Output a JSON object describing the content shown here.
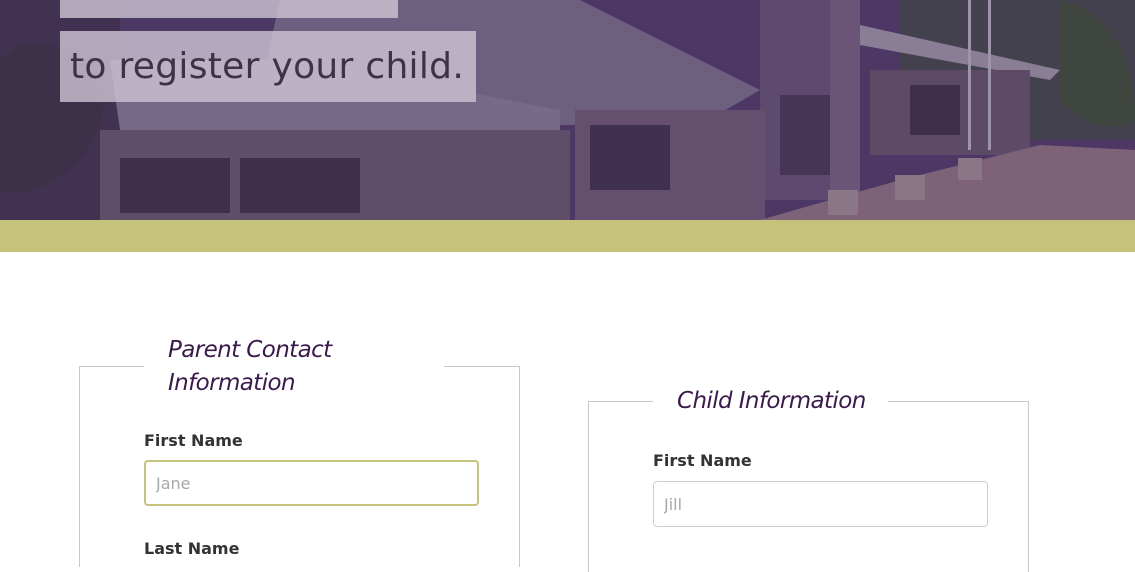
{
  "hero": {
    "headline_line2": "to register your child."
  },
  "parent_section": {
    "legend": "Parent Contact Information",
    "first_name": {
      "label": "First Name",
      "placeholder": "Jane",
      "value": ""
    },
    "last_name": {
      "label": "Last Name"
    }
  },
  "child_section": {
    "legend": "Child Information",
    "first_name": {
      "label": "First Name",
      "placeholder": "Jill",
      "value": ""
    }
  },
  "colors": {
    "hero_overlay": "#4a3461",
    "accent_band": "#c4c27b",
    "legend_text": "#3a1a4a",
    "focus_border": "#c4c27b"
  }
}
